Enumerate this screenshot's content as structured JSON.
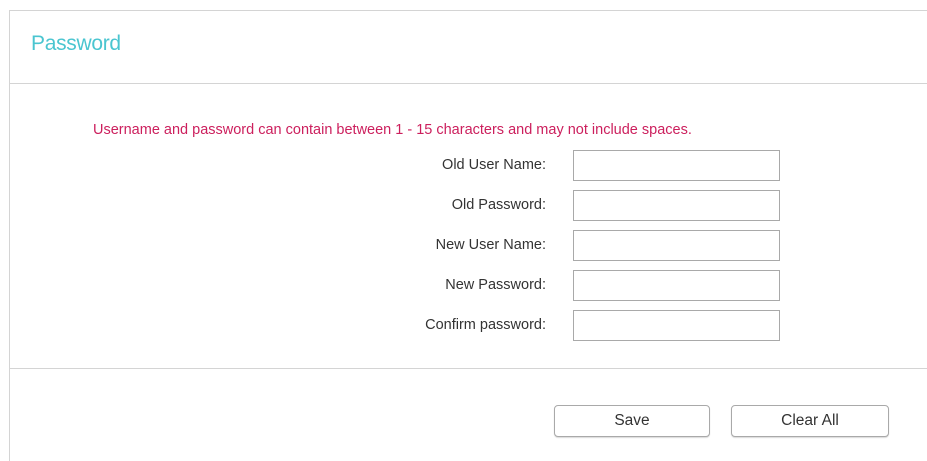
{
  "panel": {
    "title": "Password"
  },
  "form": {
    "notice": "Username and password can contain between 1 - 15 characters and may not include spaces.",
    "fields": [
      {
        "label": "Old User Name:",
        "value": "",
        "placeholder": ""
      },
      {
        "label": "Old Password:",
        "value": "",
        "placeholder": ""
      },
      {
        "label": "New User Name:",
        "value": "",
        "placeholder": ""
      },
      {
        "label": "New Password:",
        "value": "",
        "placeholder": ""
      },
      {
        "label": "Confirm password:",
        "value": "",
        "placeholder": ""
      }
    ]
  },
  "actions": {
    "save_label": "Save",
    "clear_label": "Clear All"
  },
  "colors": {
    "title": "#4ac5d0",
    "notice": "#cc1f5d",
    "border": "#d4d4d4"
  }
}
